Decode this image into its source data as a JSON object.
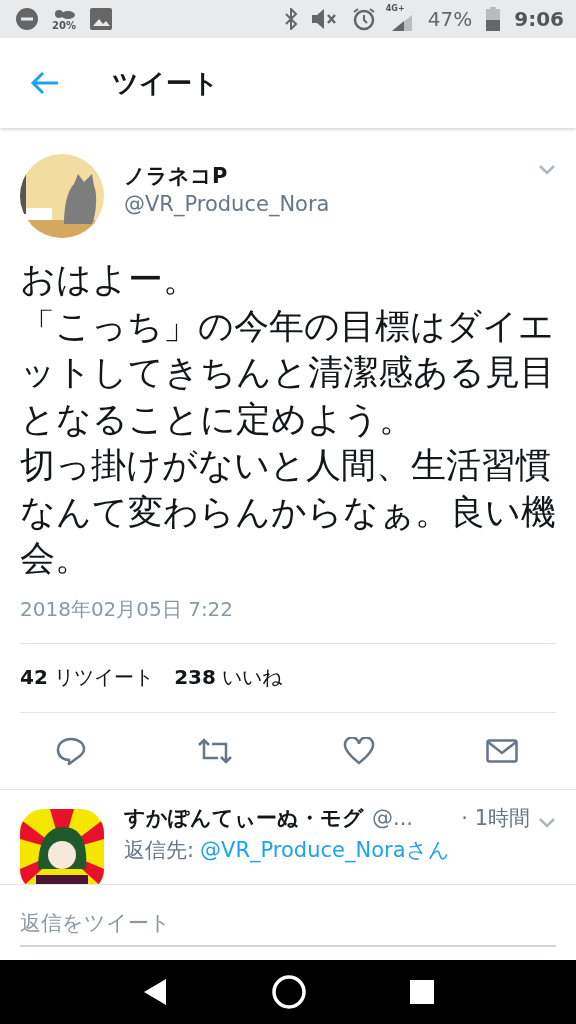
{
  "status_bar": {
    "brightness": "20%",
    "network": "4G+",
    "battery": "47%",
    "time": "9:06"
  },
  "header": {
    "title": "ツイート"
  },
  "tweet": {
    "author": "ノラネコP",
    "handle": "@VR_Produce_Nora",
    "paragraphs": [
      "おはよー。",
      "「こっち」の今年の目標はダイエットしてきちんと清潔感ある見目となることに定めよう。",
      "切っ掛けがないと人間、生活習慣なんて変わらんからなぁ。良い機会。"
    ],
    "date": "2018年02月05日 7:22",
    "stats": [
      {
        "count": "42",
        "label": "リツイート"
      },
      {
        "count": "238",
        "label": "いいね"
      }
    ]
  },
  "reply": {
    "author": "すかぽんてぃーぬ・モグ",
    "handle": "@...",
    "time": "· 1時間",
    "reply_to_label": "返信先:",
    "reply_to": "@VR_Produce_Noraさん"
  },
  "compose": {
    "placeholder": "返信をツイート"
  }
}
